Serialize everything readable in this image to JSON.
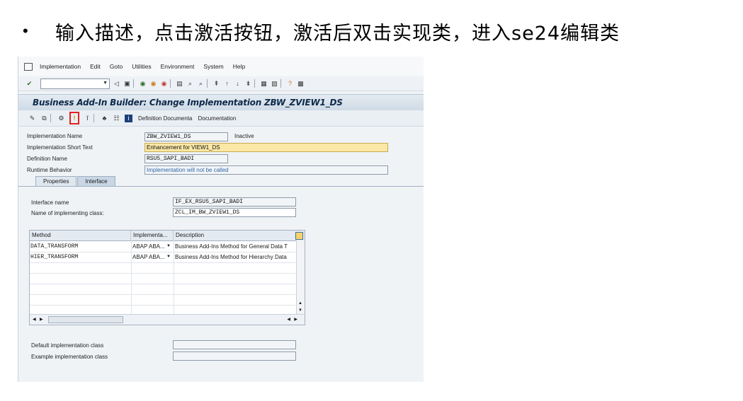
{
  "slide": {
    "bullet": "•",
    "text": "输入描述，点击激活按钮，激活后双击实现类，进入se24编辑类"
  },
  "menu": {
    "items": [
      "Implementation",
      "Edit",
      "Goto",
      "Utilities",
      "Environment",
      "System",
      "Help"
    ]
  },
  "title": "Business Add-In Builder: Change Implementation ZBW_ZVIEW1_DS",
  "app_toolbar": {
    "button1": "Definition Documenta",
    "button2": "Documentation"
  },
  "header": {
    "impl_name_label": "Implementation Name",
    "impl_name_value": "ZBW_ZVIEW1_DS",
    "status": "Inactive",
    "short_text_label": "Implementation Short Text",
    "short_text_value": "Enhancement for VIEW1_DS",
    "def_name_label": "Definition Name",
    "def_name_value": "RSU5_SAPI_BADI",
    "runtime_label": "Runtime Behavior",
    "runtime_value": "Implementation will not be called"
  },
  "tabs": [
    "Properties",
    "Interface"
  ],
  "interface": {
    "iface_label": "Interface name",
    "iface_value": "IF_EX_RSU5_SAPI_BADI",
    "class_label": "Name of implementing class:",
    "class_value": "ZCL_IM_BW_ZVIEW1_DS"
  },
  "grid": {
    "headers": [
      "Method",
      "Implementa...",
      "Description"
    ],
    "rows": [
      {
        "method": "DATA_TRANSFORM",
        "impl": "ABAP ABA...",
        "desc": "Business Add-Ins Method for General Data T"
      },
      {
        "method": "HIER_TRANSFORM",
        "impl": "ABAP ABA...",
        "desc": "Business Add-Ins Method for Hierarchy Data"
      }
    ]
  },
  "bottom": {
    "default_label": "Default implementation class",
    "example_label": "Example implementation class"
  },
  "colors": {
    "highlight": "#e41f1f",
    "title": "#0d2a4a",
    "link": "#3166a9"
  }
}
